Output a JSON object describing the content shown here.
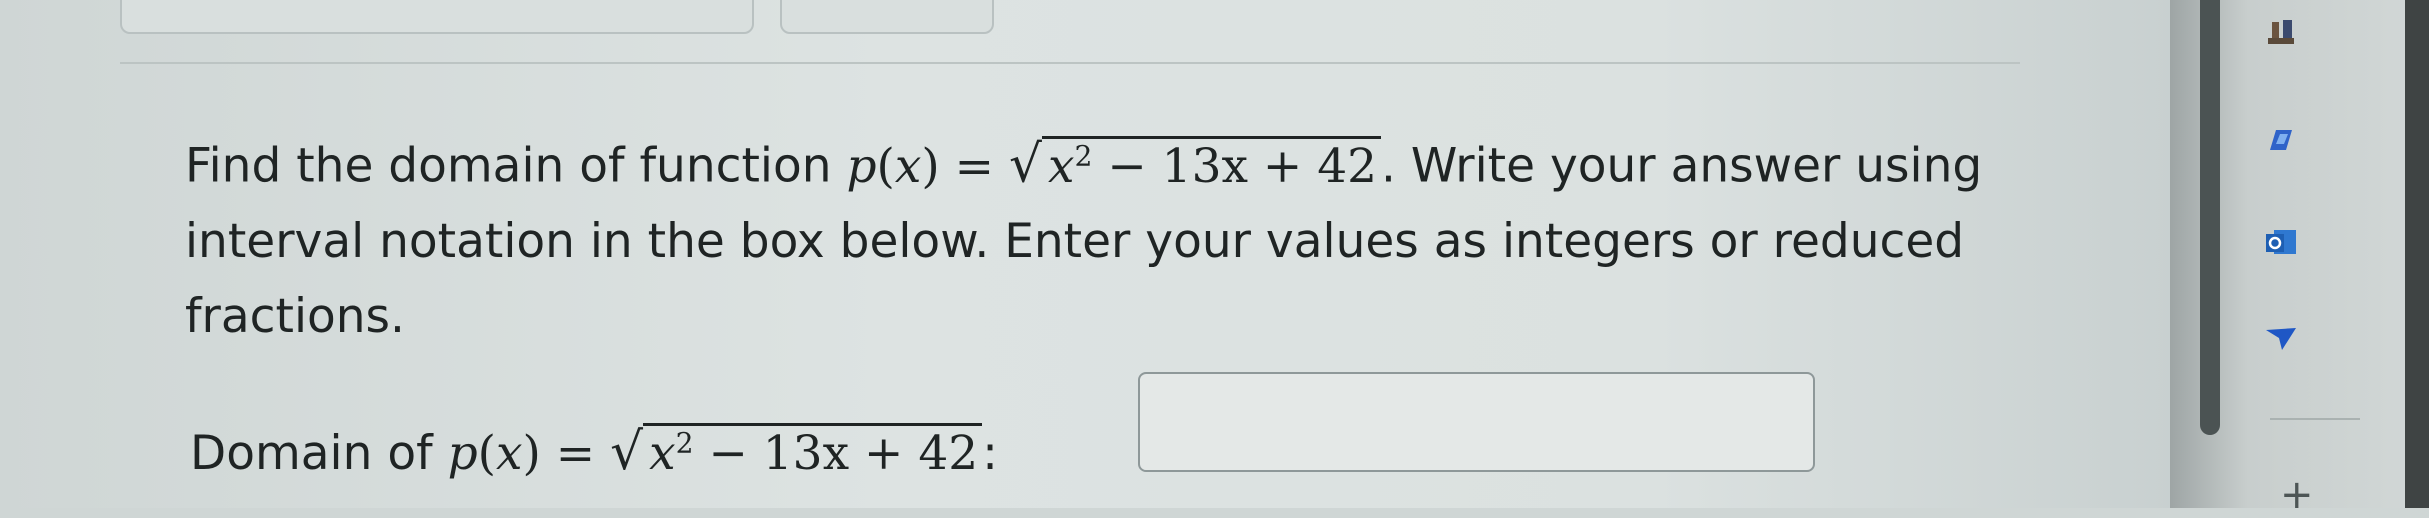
{
  "question": {
    "intro": "Find the domain of function ",
    "func_name": "p",
    "var": "x",
    "radicand_lead": "x",
    "exponent": "2",
    "radicand_tail": " − 13x + 42",
    "instructions": ". Write your answer using interval notation in the box below. Enter your values as integers or reduced fractions."
  },
  "answer": {
    "label": "Domain of ",
    "colon": ":",
    "value": ""
  },
  "sidebar": {
    "icons": [
      "chess-icon",
      "copilot-icon",
      "outlook-icon",
      "send-icon"
    ],
    "plus": "+"
  },
  "colors": {
    "text": "#1f2424",
    "copilot": "#2f63c9",
    "outlook": "#1e5fb3",
    "send": "#1f57c5"
  }
}
